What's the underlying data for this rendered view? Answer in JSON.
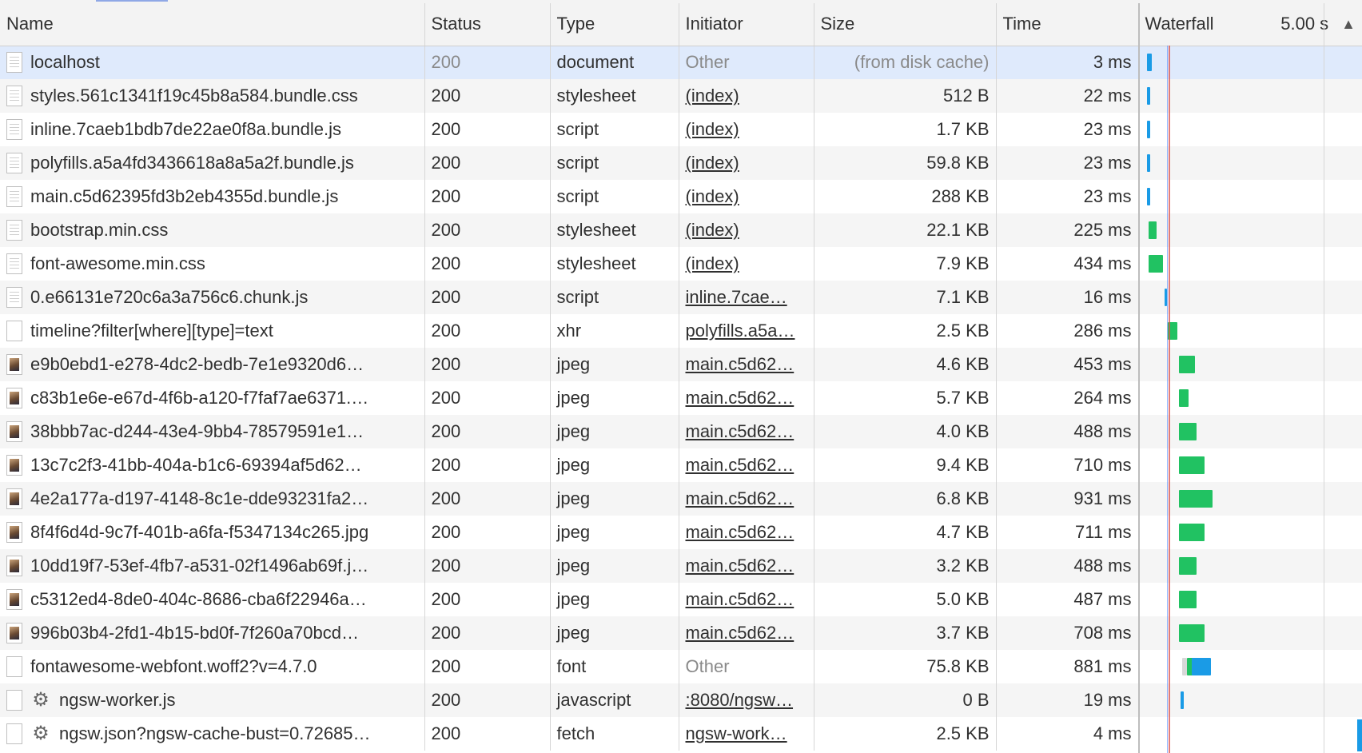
{
  "columns": {
    "name": "Name",
    "status": "Status",
    "type": "Type",
    "initiator": "Initiator",
    "size": "Size",
    "time": "Time",
    "waterfall": "Waterfall",
    "waterfall_time": "5.00 s",
    "sort_glyph": "▲"
  },
  "colors": {
    "selected_row": "#dfeafc",
    "receiving": "#21c262",
    "queueing": "#1a9be6",
    "load_line": "#d9534f"
  },
  "requests": [
    {
      "name": "localhost",
      "icon": "document-icon",
      "status": "200",
      "type": "document",
      "initiator": "Other",
      "initiator_link": false,
      "size": "(from disk cache)",
      "size_muted": true,
      "time": "3 ms",
      "selected": true
    },
    {
      "name": "styles.561c1341f19c45b8a584.bundle.css",
      "icon": "document-icon",
      "status": "200",
      "type": "stylesheet",
      "initiator": "(index)",
      "initiator_link": true,
      "size": "512 B",
      "time": "22 ms"
    },
    {
      "name": "inline.7caeb1bdb7de22ae0f8a.bundle.js",
      "icon": "document-icon",
      "status": "200",
      "type": "script",
      "initiator": "(index)",
      "initiator_link": true,
      "size": "1.7 KB",
      "time": "23 ms"
    },
    {
      "name": "polyfills.a5a4fd3436618a8a5a2f.bundle.js",
      "icon": "document-icon",
      "status": "200",
      "type": "script",
      "initiator": "(index)",
      "initiator_link": true,
      "size": "59.8 KB",
      "time": "23 ms"
    },
    {
      "name": "main.c5d62395fd3b2eb4355d.bundle.js",
      "icon": "document-icon",
      "status": "200",
      "type": "script",
      "initiator": "(index)",
      "initiator_link": true,
      "size": "288 KB",
      "time": "23 ms"
    },
    {
      "name": "bootstrap.min.css",
      "icon": "document-icon",
      "status": "200",
      "type": "stylesheet",
      "initiator": "(index)",
      "initiator_link": true,
      "size": "22.1 KB",
      "time": "225 ms"
    },
    {
      "name": "font-awesome.min.css",
      "icon": "document-icon",
      "status": "200",
      "type": "stylesheet",
      "initiator": "(index)",
      "initiator_link": true,
      "size": "7.9 KB",
      "time": "434 ms"
    },
    {
      "name": "0.e66131e720c6a3a756c6.chunk.js",
      "icon": "document-icon",
      "status": "200",
      "type": "script",
      "initiator": "inline.7cae…",
      "initiator_link": true,
      "size": "7.1 KB",
      "time": "16 ms"
    },
    {
      "name": "timeline?filter[where][type]=text",
      "icon": "blank-file-icon",
      "status": "200",
      "type": "xhr",
      "initiator": "polyfills.a5a…",
      "initiator_link": true,
      "size": "2.5 KB",
      "time": "286 ms"
    },
    {
      "name": "e9b0ebd1-e278-4dc2-bedb-7e1e9320d6…",
      "icon": "image-thumbnail-icon",
      "status": "200",
      "type": "jpeg",
      "initiator": "main.c5d62…",
      "initiator_link": true,
      "size": "4.6 KB",
      "time": "453 ms"
    },
    {
      "name": "c83b1e6e-e67d-4f6b-a120-f7faf7ae6371.…",
      "icon": "image-thumbnail-icon",
      "status": "200",
      "type": "jpeg",
      "initiator": "main.c5d62…",
      "initiator_link": true,
      "size": "5.7 KB",
      "time": "264 ms"
    },
    {
      "name": "38bbb7ac-d244-43e4-9bb4-78579591e1…",
      "icon": "image-thumbnail-icon",
      "status": "200",
      "type": "jpeg",
      "initiator": "main.c5d62…",
      "initiator_link": true,
      "size": "4.0 KB",
      "time": "488 ms"
    },
    {
      "name": "13c7c2f3-41bb-404a-b1c6-69394af5d62…",
      "icon": "image-thumbnail-icon",
      "status": "200",
      "type": "jpeg",
      "initiator": "main.c5d62…",
      "initiator_link": true,
      "size": "9.4 KB",
      "time": "710 ms"
    },
    {
      "name": "4e2a177a-d197-4148-8c1e-dde93231fa2…",
      "icon": "image-thumbnail-icon",
      "status": "200",
      "type": "jpeg",
      "initiator": "main.c5d62…",
      "initiator_link": true,
      "size": "6.8 KB",
      "time": "931 ms"
    },
    {
      "name": "8f4f6d4d-9c7f-401b-a6fa-f5347134c265.jpg",
      "icon": "image-thumbnail-icon",
      "status": "200",
      "type": "jpeg",
      "initiator": "main.c5d62…",
      "initiator_link": true,
      "size": "4.7 KB",
      "time": "711 ms"
    },
    {
      "name": "10dd19f7-53ef-4fb7-a531-02f1496ab69f.j…",
      "icon": "image-thumbnail-icon",
      "status": "200",
      "type": "jpeg",
      "initiator": "main.c5d62…",
      "initiator_link": true,
      "size": "3.2 KB",
      "time": "488 ms"
    },
    {
      "name": "c5312ed4-8de0-404c-8686-cba6f22946a…",
      "icon": "image-thumbnail-icon",
      "status": "200",
      "type": "jpeg",
      "initiator": "main.c5d62…",
      "initiator_link": true,
      "size": "5.0 KB",
      "time": "487 ms"
    },
    {
      "name": "996b03b4-2fd1-4b15-bd0f-7f260a70bcd…",
      "icon": "image-thumbnail-icon",
      "status": "200",
      "type": "jpeg",
      "initiator": "main.c5d62…",
      "initiator_link": true,
      "size": "3.7 KB",
      "time": "708 ms"
    },
    {
      "name": "fontawesome-webfont.woff2?v=4.7.0",
      "icon": "blank-file-icon",
      "status": "200",
      "type": "font",
      "initiator": "Other",
      "initiator_link": false,
      "size": "75.8 KB",
      "time": "881 ms",
      "initiator_muted": true
    },
    {
      "name": "ngsw-worker.js",
      "icon": "service-worker-gear-icon",
      "status": "200",
      "type": "javascript",
      "initiator": ":8080/ngsw…",
      "initiator_link": true,
      "size": "0 B",
      "time": "19 ms"
    },
    {
      "name": "ngsw.json?ngsw-cache-bust=0.72685…",
      "icon": "service-worker-gear-icon",
      "status": "200",
      "type": "fetch",
      "initiator": "ngsw-work…",
      "initiator_link": true,
      "size": "2.5 KB",
      "time": "4 ms"
    }
  ]
}
